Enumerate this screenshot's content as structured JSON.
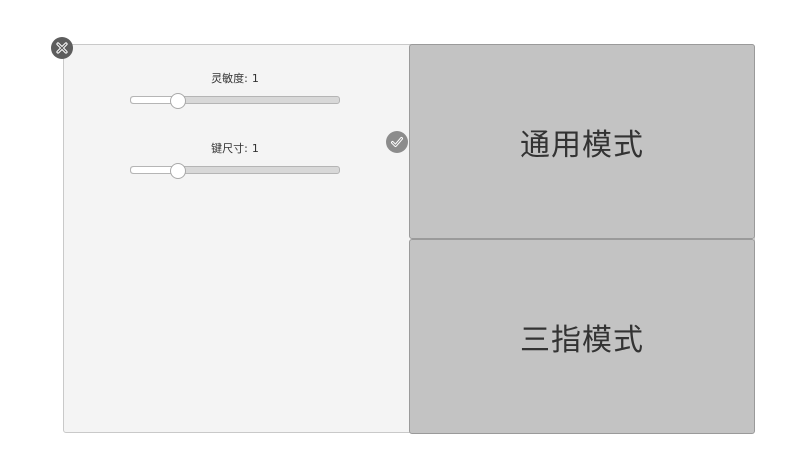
{
  "settings": {
    "sensitivity": {
      "label": "灵敏度:",
      "value": "1",
      "level": 0.22
    },
    "key_size": {
      "label": "键尺寸:",
      "value": "1",
      "level": 0.22
    }
  },
  "modes": {
    "general": "通用模式",
    "three_finger": "三指模式"
  },
  "icons": {
    "close": "close-icon",
    "confirm": "checkmark-icon"
  },
  "colors": {
    "panel_bg": "#f4f4f4",
    "mode_button_bg": "#c3c3c3",
    "close_button_bg": "#5d5d5d",
    "confirm_button_bg": "#8c8c8c"
  }
}
